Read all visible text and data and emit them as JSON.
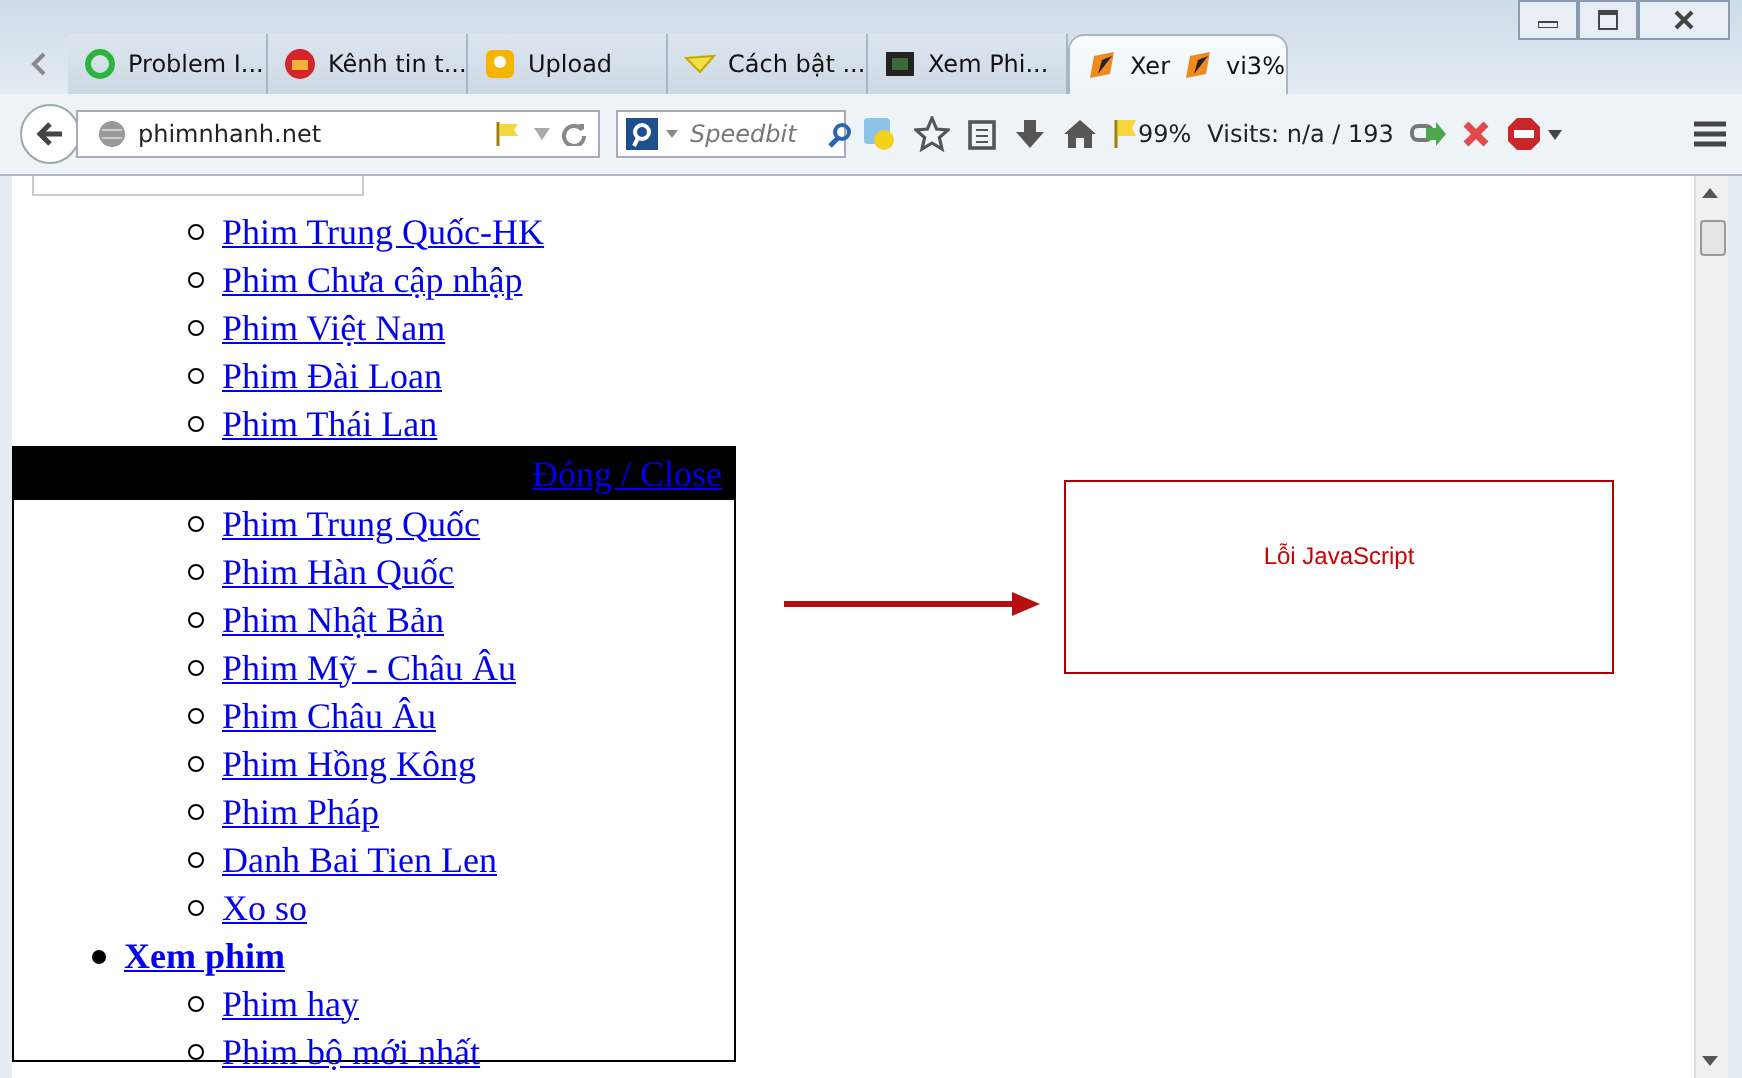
{
  "tabs": [
    {
      "label": "Problem I...",
      "kind": "spinner",
      "selected": false
    },
    {
      "label": "Kênh tin t...",
      "kind": "badge",
      "selected": false
    },
    {
      "label": "Upload",
      "kind": "bulb",
      "selected": false
    },
    {
      "label": "Cách bật ...",
      "kind": "fold",
      "selected": false
    },
    {
      "label": "Xem Phi...",
      "kind": "film",
      "selected": false
    },
    {
      "label": "Xer",
      "kind": "fox",
      "selected": true,
      "trailing_text": "vi3%"
    }
  ],
  "toolbar": {
    "url": "phimnhanh.net",
    "search_placeholder": "Speedbit",
    "rating": "99%",
    "visits": "Visits: n/a / 193"
  },
  "menu": [
    {
      "children": [
        "Phim Trung Quốc-HK",
        "Phim Chưa cập nhập",
        "Phim Việt Nam",
        "Phim Đài Loan",
        "Phim Thái Lan"
      ]
    }
  ],
  "popup": {
    "close_link": "Đóng / Close",
    "menu": [
      {
        "children": [
          "Phim Trung Quốc",
          "Phim Hàn Quốc",
          "Phim Nhật Bản",
          "Phim Mỹ - Châu Âu",
          "Phim Châu Âu",
          "Phim Hồng Kông",
          "Phim Pháp",
          "Danh Bai Tien Len",
          "Xo so"
        ]
      },
      {
        "label": "Xem phim",
        "children": [
          "Phim hay",
          "Phim bộ mới nhất"
        ]
      }
    ]
  },
  "error_box": {
    "message": "Lỗi JavaScript"
  }
}
